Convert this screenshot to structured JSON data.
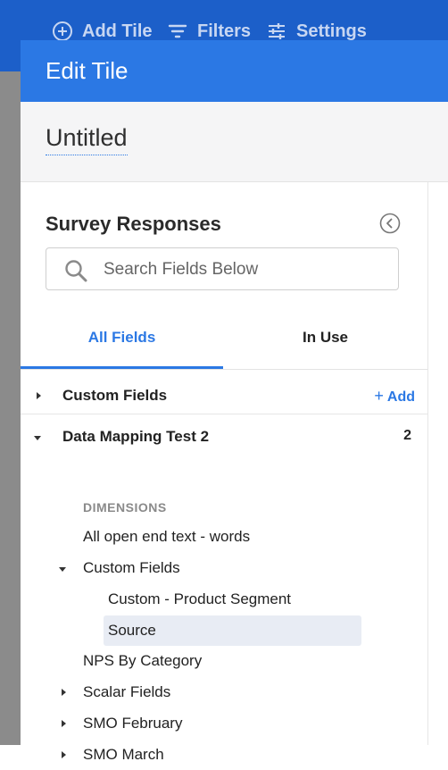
{
  "toolbar": {
    "add_tile": "Add Tile",
    "filters": "Filters",
    "settings": "Settings"
  },
  "modal": {
    "title": "Edit Tile",
    "tile_name": "Untitled"
  },
  "panel": {
    "title": "Survey Responses",
    "search": {
      "placeholder": "Search Fields Below",
      "value": ""
    },
    "tabs": [
      {
        "label": "All Fields",
        "active": true
      },
      {
        "label": "In Use",
        "active": false
      }
    ]
  },
  "tree": {
    "custom_fields_top": {
      "label": "Custom Fields",
      "add_label": "Add",
      "add_symbol": "+"
    },
    "data_mapping": {
      "label": "Data Mapping Test 2",
      "count": "2"
    },
    "dimensions_header": "DIMENSIONS",
    "open_end": "All open end text - words",
    "custom_fields_nested": "Custom Fields",
    "product_segment": "Custom - Product Segment",
    "source": "Source",
    "nps": "NPS By Category",
    "scalar": "Scalar Fields",
    "smo_feb": "SMO February",
    "smo_mar": "SMO March"
  },
  "colors": {
    "accent": "#2b78e4",
    "toolbar_bg": "#1c5fc9",
    "selected_row": "#e8ecf4"
  }
}
